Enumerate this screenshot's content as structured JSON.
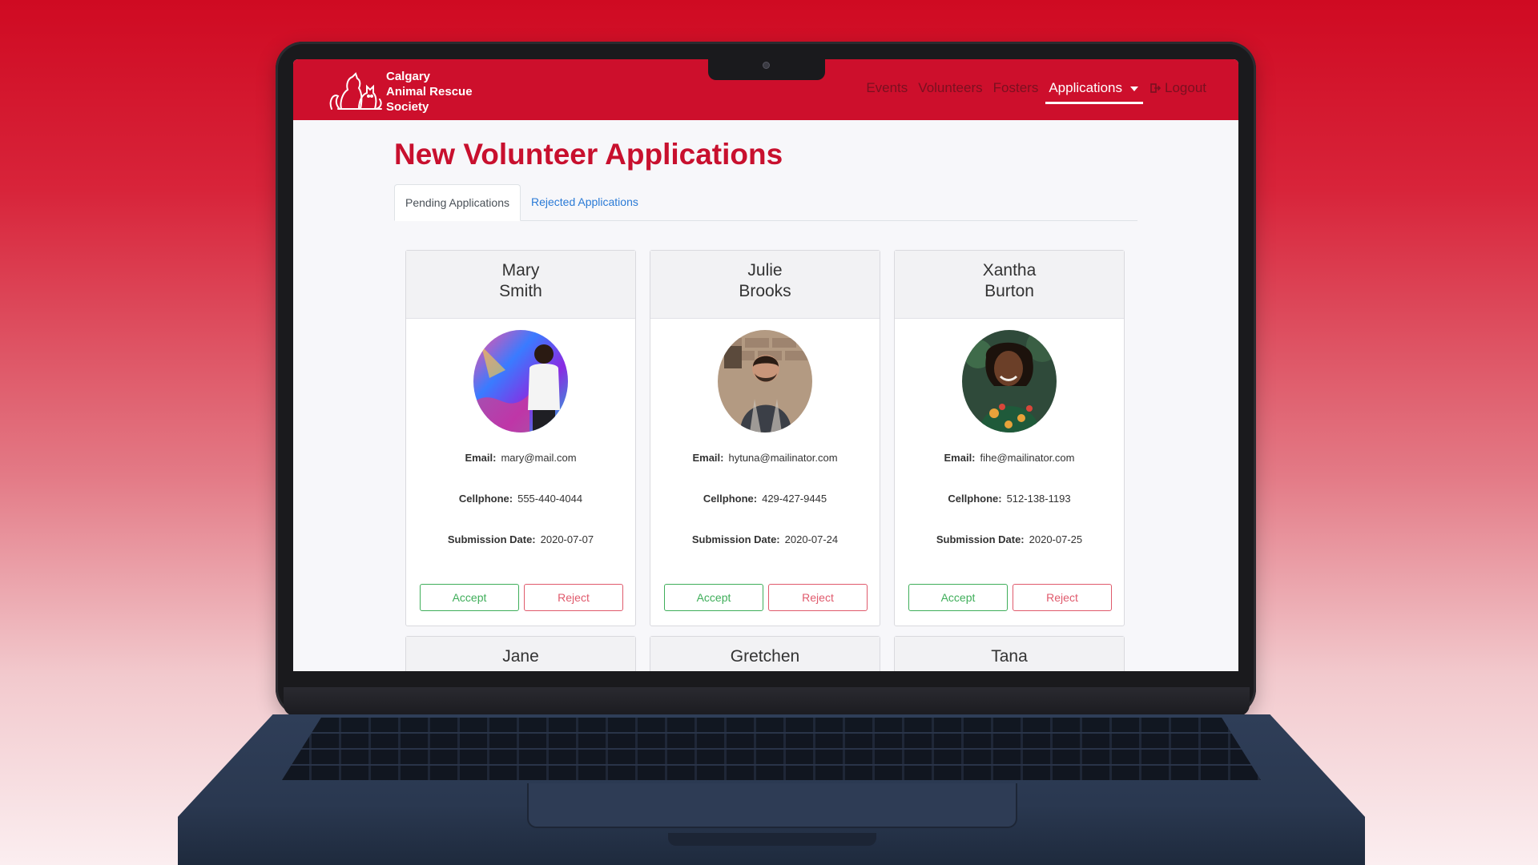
{
  "brand": {
    "line1": "Calgary",
    "line2": "Animal Rescue",
    "line3": "Society"
  },
  "nav": {
    "events": "Events",
    "volunteers": "Volunteers",
    "fosters": "Fosters",
    "applications": "Applications",
    "logout": "Logout"
  },
  "page": {
    "title": "New Volunteer Applications"
  },
  "tabs": {
    "pending": "Pending Applications",
    "rejected": "Rejected Applications"
  },
  "labels": {
    "email": "Email:",
    "cellphone": "Cellphone:",
    "submission_date": "Submission Date:"
  },
  "buttons": {
    "accept": "Accept",
    "reject": "Reject"
  },
  "applicants": [
    {
      "first": "Mary",
      "last": "Smith",
      "email": "mary@mail.com",
      "cellphone": "555-440-4044",
      "date": "2020-07-07"
    },
    {
      "first": "Julie",
      "last": "Brooks",
      "email": "hytuna@mailinator.com",
      "cellphone": "429-427-9445",
      "date": "2020-07-24"
    },
    {
      "first": "Xantha",
      "last": "Burton",
      "email": "fihe@mailinator.com",
      "cellphone": "512-138-1193",
      "date": "2020-07-25"
    },
    {
      "first": "Jane"
    },
    {
      "first": "Gretchen"
    },
    {
      "first": "Tana"
    }
  ],
  "colors": {
    "brand_red": "#cd0f2c",
    "accept_green": "#3fae5a",
    "reject_red": "#e05a6c",
    "tab_link_blue": "#2a7ad6"
  },
  "icons": {
    "logo": "cat-dog-outline-logo",
    "logout": "sign-out-icon",
    "dropdown": "caret-down-icon"
  }
}
